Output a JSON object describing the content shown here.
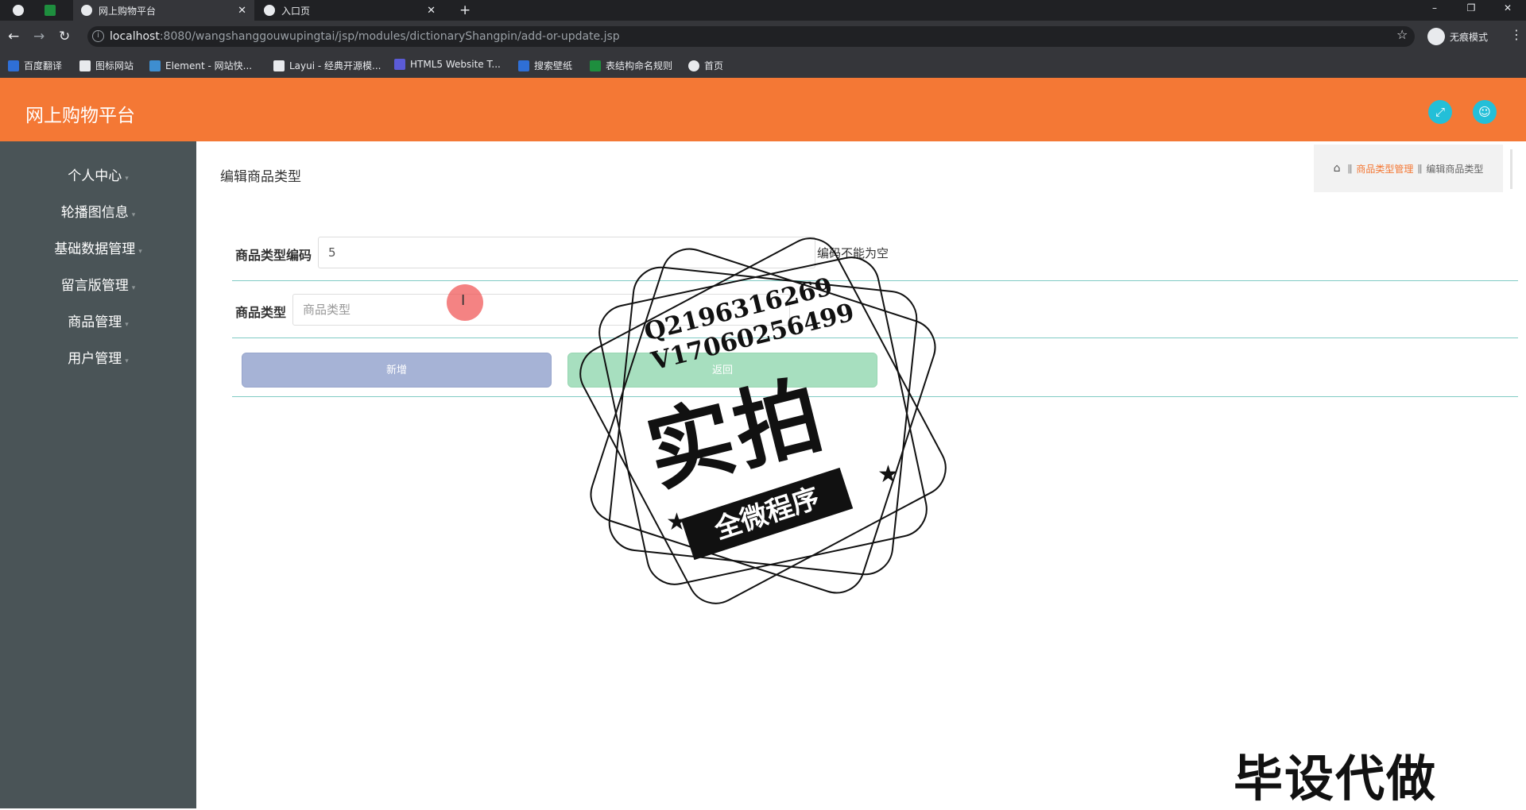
{
  "browser": {
    "tabs": [
      {
        "label": ""
      },
      {
        "label": ""
      },
      {
        "label": "网上购物平台",
        "close": "✕"
      },
      {
        "label": "入口页",
        "close": "✕"
      }
    ],
    "new_tab": "+",
    "window_controls": [
      "–",
      "❐",
      "✕"
    ],
    "url_host": "localhost",
    "url_rest": ":8080/wangshanggouwupingtai/jsp/modules/dictionaryShangpin/add-or-update.jsp",
    "incognito_label": "无痕模式",
    "bookmarks": [
      {
        "label": "百度翻译",
        "color": "#2f6fd6"
      },
      {
        "label": "图标网站",
        "color": "#e8eaed"
      },
      {
        "label": "Element - 网站快...",
        "color": "#3e8ed0"
      },
      {
        "label": "Layui - 经典开源模...",
        "color": "#e8eaed"
      },
      {
        "label": "HTML5 Website T...",
        "color": "#5b5bd6"
      },
      {
        "label": "搜索壁纸",
        "color": "#2f6fd6"
      },
      {
        "label": "表结构命名规则",
        "color": "#1e8e3e"
      },
      {
        "label": "首页",
        "color": "#e8eaed"
      }
    ]
  },
  "app": {
    "title": "网上购物平台",
    "accent": "#f47835",
    "sidebar": {
      "items": [
        {
          "label": "个人中心"
        },
        {
          "label": "轮播图信息"
        },
        {
          "label": "基础数据管理"
        },
        {
          "label": "留言版管理"
        },
        {
          "label": "商品管理"
        },
        {
          "label": "用户管理"
        }
      ]
    },
    "page_title": "编辑商品类型",
    "breadcrumb": {
      "sep": "ǁ",
      "parent": "商品类型管理",
      "current": "编辑商品类型"
    },
    "form": {
      "code_label": "商品类型编码",
      "code_value": "5",
      "code_hint": "编码不能为空",
      "type_label": "商品类型",
      "type_placeholder": "商品类型",
      "add_button": "新增",
      "back_button": "返回"
    }
  },
  "overlay": {
    "contact_q": "Q2196316269",
    "contact_v": "V17060256499",
    "stamp_big": "实拍",
    "stamp_ribbon": "全微程序",
    "watermark": "毕设代做"
  }
}
